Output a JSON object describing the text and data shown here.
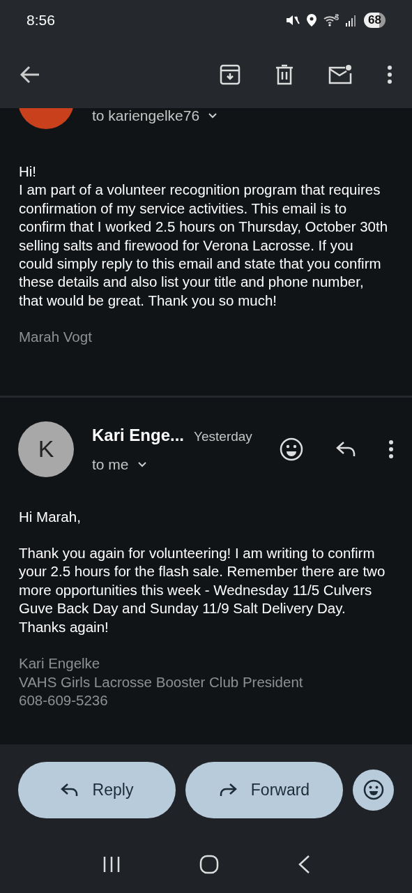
{
  "status_bar": {
    "time": "8:56",
    "battery": "68"
  },
  "messages": [
    {
      "color": "#c8401c",
      "recipient": "to kariengelke76",
      "body": [
        "Hi!\nI am part of a volunteer recognition program that requires confirmation of my service activities. This email is to confirm that I worked 2.5 hours on Thursday, October 30th selling salts and firewood for Verona Lacrosse. If you could simply reply to this email and state that you confirm these details and also list your title and phone number, that would be great. Thank you so much!"
      ],
      "signature": [
        "Marah Vogt"
      ]
    },
    {
      "avatar_letter": "K",
      "color": "#a8a8a8",
      "sender": "Kari Enge...",
      "time": "Yesterday",
      "recipient": "to me",
      "body": [
        "Hi Marah,",
        "Thank you again for volunteering! I am writing to confirm your 2.5 hours for the flash sale. Remember there are two more opportunities this week - Wednesday 11/5 Culvers Guve Back Day and Sunday 11/9 Salt Delivery Day. Thanks again!"
      ],
      "signature": [
        "Kari Engelke",
        "VAHS Girls Lacrosse Booster Club President",
        "608-609-5236"
      ]
    }
  ],
  "actions": [
    {
      "kind": "reply",
      "label": "Reply"
    },
    {
      "kind": "forward",
      "label": "Forward"
    },
    {
      "kind": "emoji"
    }
  ]
}
